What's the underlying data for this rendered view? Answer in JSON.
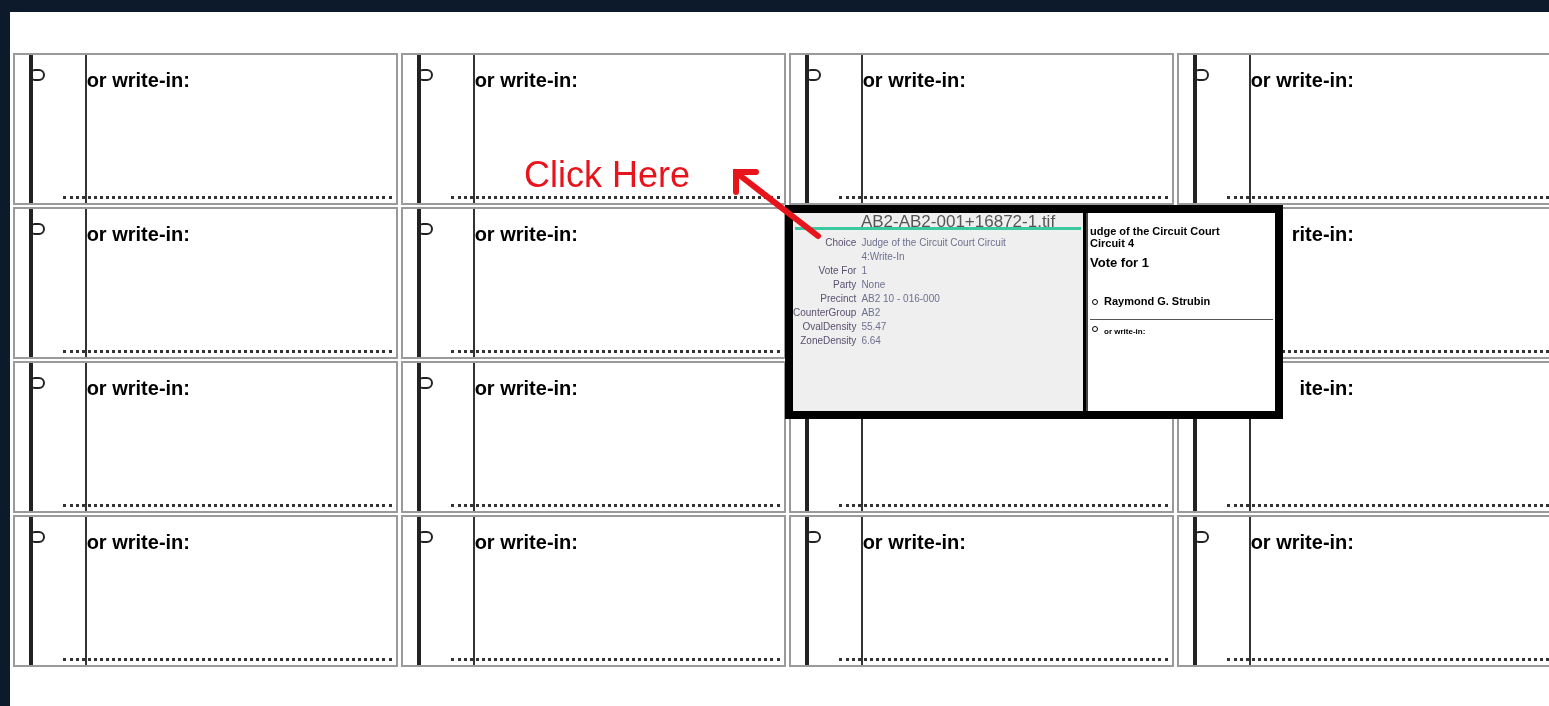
{
  "tiles": [
    {
      "oval": true,
      "text": "or write-in:"
    },
    {
      "oval": true,
      "text": "or write-in:"
    },
    {
      "oval": true,
      "text": "or write-in:"
    },
    {
      "oval": true,
      "text": "or write-in:"
    },
    {
      "oval": true,
      "text": "or write-in:"
    },
    {
      "oval": true,
      "text": "or write-in:"
    },
    {
      "oval": false,
      "text": "rite-in:"
    },
    {
      "oval": true,
      "text": "or write-in:"
    },
    {
      "oval": true,
      "text": "or write-in:"
    },
    {
      "oval": false
    },
    {
      "oval": false,
      "text": "ite-in:"
    },
    {
      "oval": true,
      "text": "or write-in:"
    },
    {
      "oval": true,
      "text": "or write-in:"
    },
    {
      "oval": true,
      "text": "or write-in:"
    },
    {
      "oval": true,
      "text": "or write-in:"
    }
  ],
  "popup": {
    "title": "AB2-AB2-001+16872-1.tif",
    "fields": [
      {
        "label": "Choice",
        "value": "Judge of the Circuit Court Circuit 4:Write-In"
      },
      {
        "label": "Vote For",
        "value": "1"
      },
      {
        "label": "Party",
        "value": "None"
      },
      {
        "label": "Precinct",
        "value": "AB2 10 - 016-000"
      },
      {
        "label": "CounterGroup",
        "value": "AB2"
      },
      {
        "label": "OvalDensity",
        "value": "55.47"
      },
      {
        "label": "ZoneDensity",
        "value": "6.64"
      }
    ],
    "ballot": {
      "contest": [
        "udge of the Circuit Court",
        "Circuit 4"
      ],
      "vote_for": "Vote for 1",
      "candidates": [
        {
          "name": "Raymond G. Strubin"
        },
        {
          "name": "or write-in:"
        }
      ]
    }
  },
  "annotation": {
    "text": "Click Here"
  }
}
